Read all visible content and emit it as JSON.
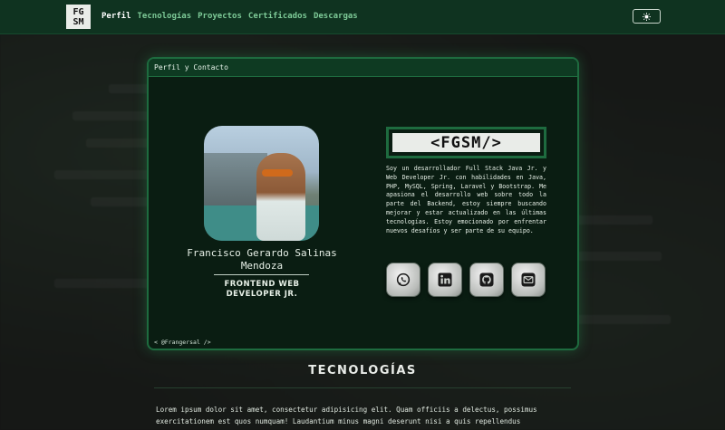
{
  "navbar": {
    "logo_line1": "FG",
    "logo_line2": "SM",
    "links": [
      "Perfil",
      "Tecnologías",
      "Proyectos",
      "Certificados",
      "Descargas"
    ],
    "active_link": "Perfil",
    "theme_icon": "sun-icon"
  },
  "card": {
    "header": "Perfil y Contacto",
    "name": "Francisco Gerardo Salinas Mendoza",
    "role_line1": "FRONTEND WEB",
    "role_line2": "DEVELOPER JR.",
    "handle": "< @Frangersal />",
    "brand": "<FGSM/>",
    "bio": "Soy un desarrollador Full Stack Java Jr. y Web Developer Jr. con habilidades en Java, PHP, MySQL, Spring, Laravel y Bootstrap. Me apasiona el desarrollo web sobre todo la parte del Backend, estoy siempre buscando mejorar y estar actualizado en las últimas tecnologías. Estoy emocionado por enfrentar nuevos desafíos y ser parte de su equipo.",
    "socials": [
      "whatsapp-icon",
      "linkedin-icon",
      "github-icon",
      "email-icon"
    ]
  },
  "technologies": {
    "title": "TECNOLOGÍAS",
    "text": "Lorem ipsum dolor sit amet, consectetur adipisicing elit. Quam officiis a delectus, possimus exercitationem est quos numquam! Laudantium minus magni deserunt nisi a quis repellendus"
  },
  "colors": {
    "navbar_bg": "#0f3320",
    "accent": "#1e6b3f",
    "card_bg": "#0a1d12",
    "page_bg": "#141414"
  }
}
